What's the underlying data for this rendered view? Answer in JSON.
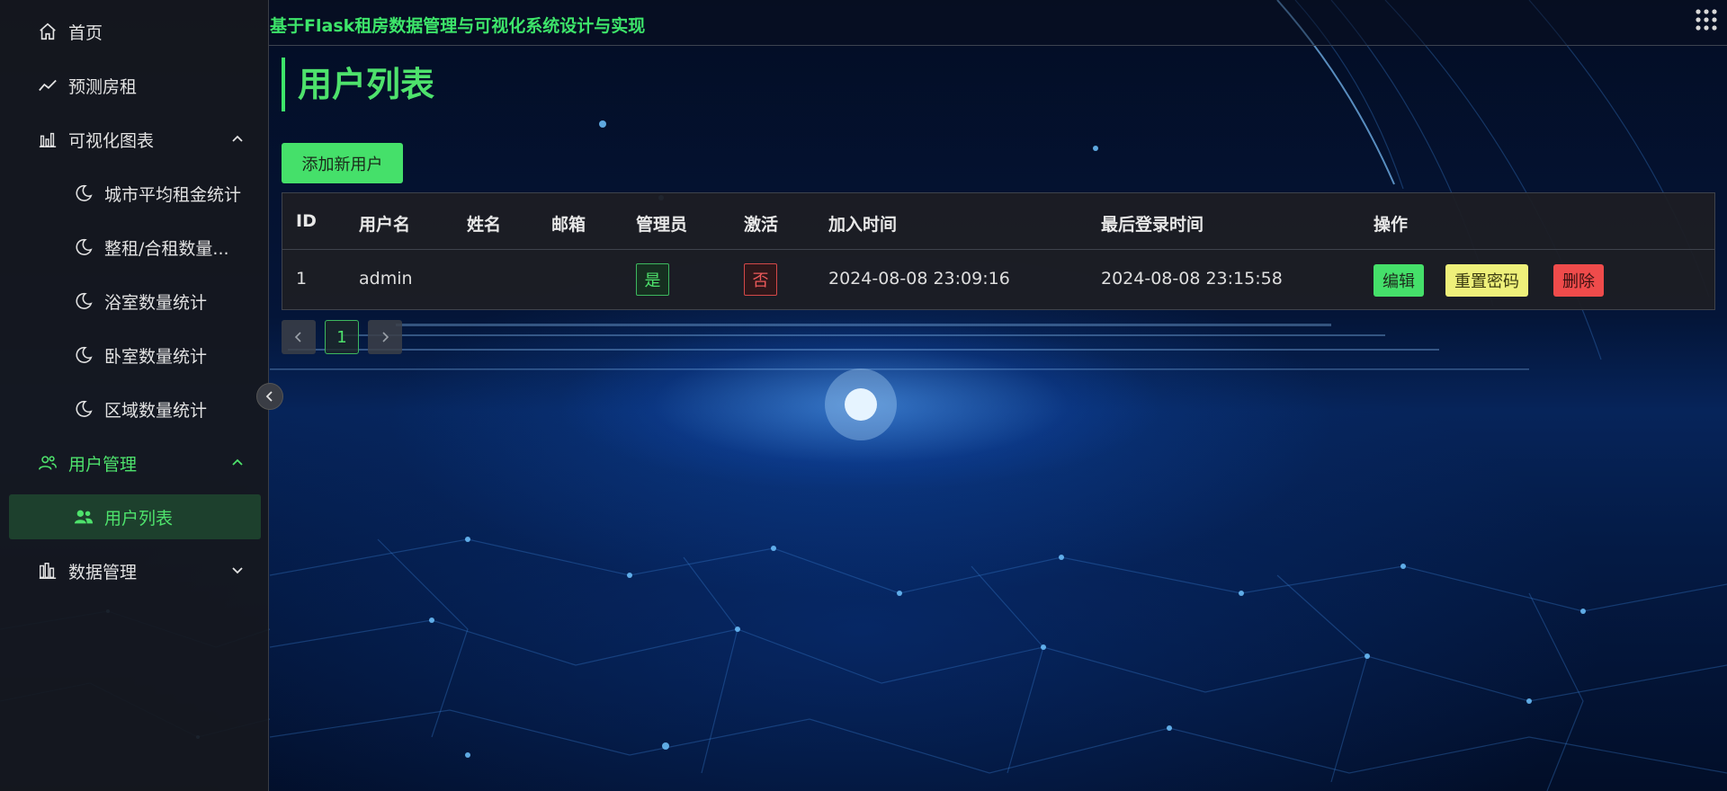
{
  "app": {
    "title": "基于Flask租房数据管理与可视化系统设计与实现"
  },
  "sidebar": {
    "items": [
      {
        "label": "首页",
        "icon": "home-icon"
      },
      {
        "label": "预测房租",
        "icon": "trend-icon"
      },
      {
        "label": "可视化图表",
        "icon": "bar-chart-icon",
        "expanded": true
      },
      {
        "label": "城市平均租金统计",
        "icon": "moon-icon"
      },
      {
        "label": "整租/合租数量...",
        "icon": "moon-icon"
      },
      {
        "label": "浴室数量统计",
        "icon": "moon-icon"
      },
      {
        "label": "卧室数量统计",
        "icon": "moon-icon"
      },
      {
        "label": "区域数量统计",
        "icon": "moon-icon"
      },
      {
        "label": "用户管理",
        "icon": "users-icon",
        "expanded": true
      },
      {
        "label": "用户列表",
        "icon": "people-icon",
        "selected": true
      },
      {
        "label": "数据管理",
        "icon": "database-icon",
        "expanded": false
      }
    ]
  },
  "main": {
    "page_title": "用户列表",
    "add_button": "添加新用户",
    "table": {
      "columns": [
        "ID",
        "用户名",
        "姓名",
        "邮箱",
        "管理员",
        "激活",
        "加入时间",
        "最后登录时间",
        "操作"
      ],
      "rows": [
        {
          "id": "1",
          "username": "admin",
          "name": "",
          "email": "",
          "is_admin": "是",
          "is_active": "否",
          "joined": "2024-08-08 23:09:16",
          "last_login": "2024-08-08 23:15:58",
          "actions": {
            "edit": "编辑",
            "reset": "重置密码",
            "delete": "删除"
          }
        }
      ]
    },
    "pagination": {
      "current": "1"
    }
  },
  "colors": {
    "accent": "#4ee26c",
    "danger": "#ef4b4b",
    "warning": "#eef07a",
    "sidebar_bg": "#16181e"
  }
}
